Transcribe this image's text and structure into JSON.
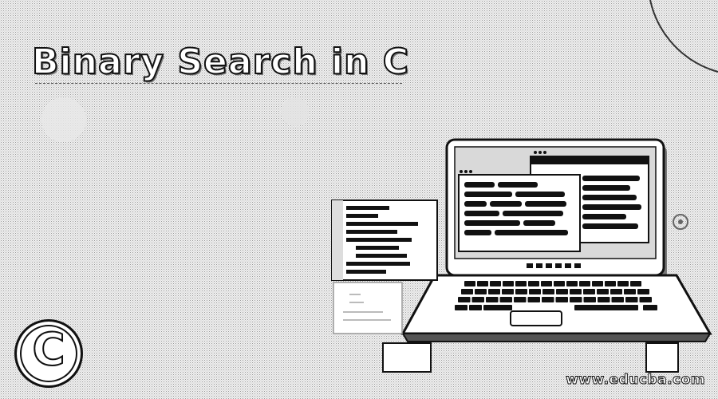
{
  "title": "Binary Search in C",
  "logo": {
    "letter": "C"
  },
  "brand": {
    "url": "www.educba.com"
  },
  "icons": [
    "c-language-logo",
    "laptop-illustration",
    "code-window-icon",
    "document-icon"
  ],
  "colors": {
    "ink": "#111111",
    "paper": "#ffffff",
    "halftone": "#9a9a9a"
  }
}
